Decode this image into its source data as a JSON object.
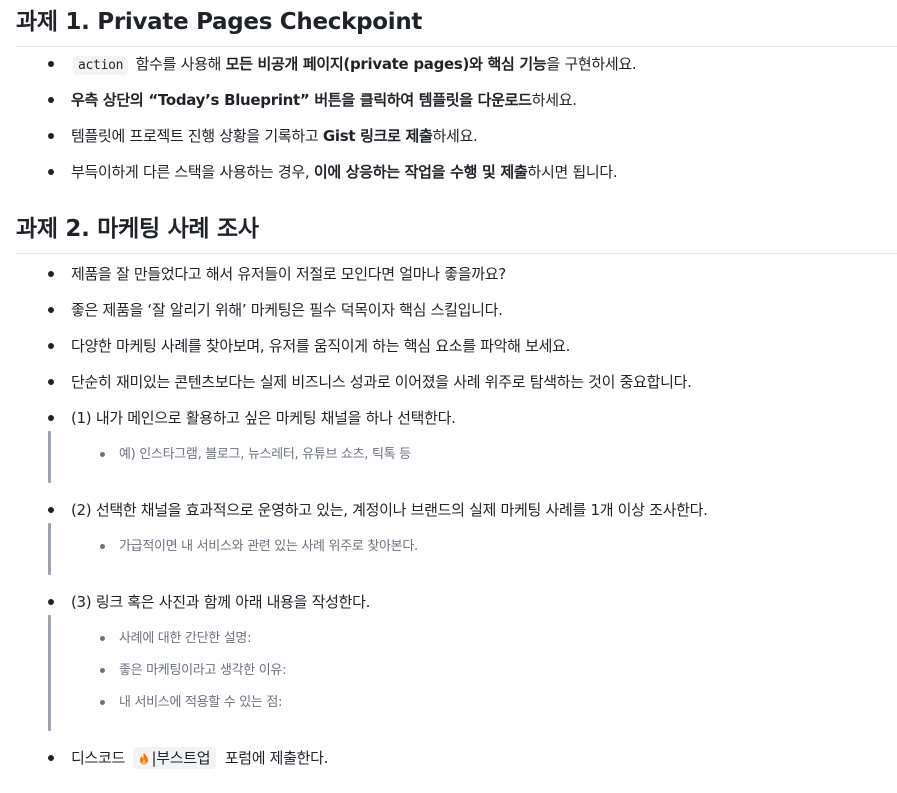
{
  "section1": {
    "title": "과제 1. Private Pages Checkpoint",
    "items": [
      {
        "code": "action",
        "t1": " 함수를 사용해 ",
        "b1": "모든 비공개 페이지(private pages)와 핵심 기능",
        "t2": "을 구현하세요."
      },
      {
        "b1": "우측 상단의 “Today’s Blueprint” 버튼을 클릭하여 템플릿을 다운로드",
        "t1": "하세요."
      },
      {
        "t1": "템플릿에 프로젝트 진행 상황을 기록하고 ",
        "b1": "Gist 링크로 제출",
        "t2": "하세요."
      },
      {
        "t1": "부득이하게 다른 스택을 사용하는 경우, ",
        "b1": "이에 상응하는 작업을 수행 및 제출",
        "t2": "하시면 됩니다."
      }
    ]
  },
  "section2": {
    "title": "과제 2. 마케팅 사례 조사",
    "items": [
      "제품을 잘 만들었다고 해서 유저들이 저절로 모인다면 얼마나 좋을까요?",
      "좋은 제품을 ‘잘 알리기 위해’ 마케팅은 필수 덕목이자 핵심 스킬입니다.",
      "다양한 마케팅 사례를 찾아보며, 유저를 움직이게 하는 핵심 요소를 파악해 보세요.",
      "단순히 재미있는 콘텐츠보다는 실제 비즈니스 성과로 이어졌을 사례 위주로 탐색하는 것이 중요합니다."
    ],
    "steps": [
      {
        "label": "(1) 내가 메인으로 활용하고 싶은 마케팅 채널을 하나 선택한다.",
        "subs": [
          "예) 인스타그램, 블로그, 뉴스레터, 유튜브 쇼츠, 틱톡 등"
        ]
      },
      {
        "label": "(2) 선택한 채널을 효과적으로 운영하고 있는, 계정이나 브랜드의 실제 마케팅 사례를 1개 이상 조사한다.",
        "subs": [
          "가급적이면 내 서비스와 관련 있는 사례 위주로 찾아본다."
        ]
      },
      {
        "label": "(3) 링크 혹은 사진과 함께 아래 내용을 작성한다.",
        "subs": [
          "사례에 대한 간단한 설명:",
          "좋은 마케팅이라고 생각한 이유:",
          "내 서비스에 적용할 수 있는 점:"
        ]
      }
    ],
    "final": {
      "t1": "디스코드 ",
      "tag": "|부스트업",
      "t2": " 포럼에 제출한다."
    }
  },
  "icons": {
    "fire": "fire-emoji-icon"
  },
  "colors": {
    "text": "#1f2328",
    "muted": "#6b7280",
    "quote_bar": "#9ca3af",
    "code_bg": "#f2f3f5"
  }
}
